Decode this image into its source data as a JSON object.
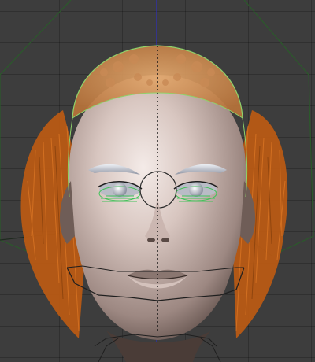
{
  "viewport": {
    "view": "front-orthographic",
    "grid": true,
    "icons": [
      "vertical-axis-line",
      "head-model-icon"
    ]
  },
  "scene": {
    "object": "head-model",
    "parts": [
      "hair-cap",
      "hair-strands",
      "eyebrows",
      "eyes",
      "nose",
      "lips",
      "wireframe-cage"
    ],
    "colors": {
      "background": "#3d3d3d",
      "grid": "#333333",
      "skin_light": "#e8dad6",
      "skin_mid": "#b4a09a",
      "skin_dark": "#5a4a45",
      "hair": "#c8661a",
      "hair_cap": "#d4945a",
      "eyebrow": "#c8ccd6",
      "eye_guide": "#43c25a",
      "cage_line": "#2b5a2b",
      "selection_outline": "#8fd36b",
      "z_axis": "#2b2bd8",
      "symmetry_line": "#111111"
    }
  }
}
